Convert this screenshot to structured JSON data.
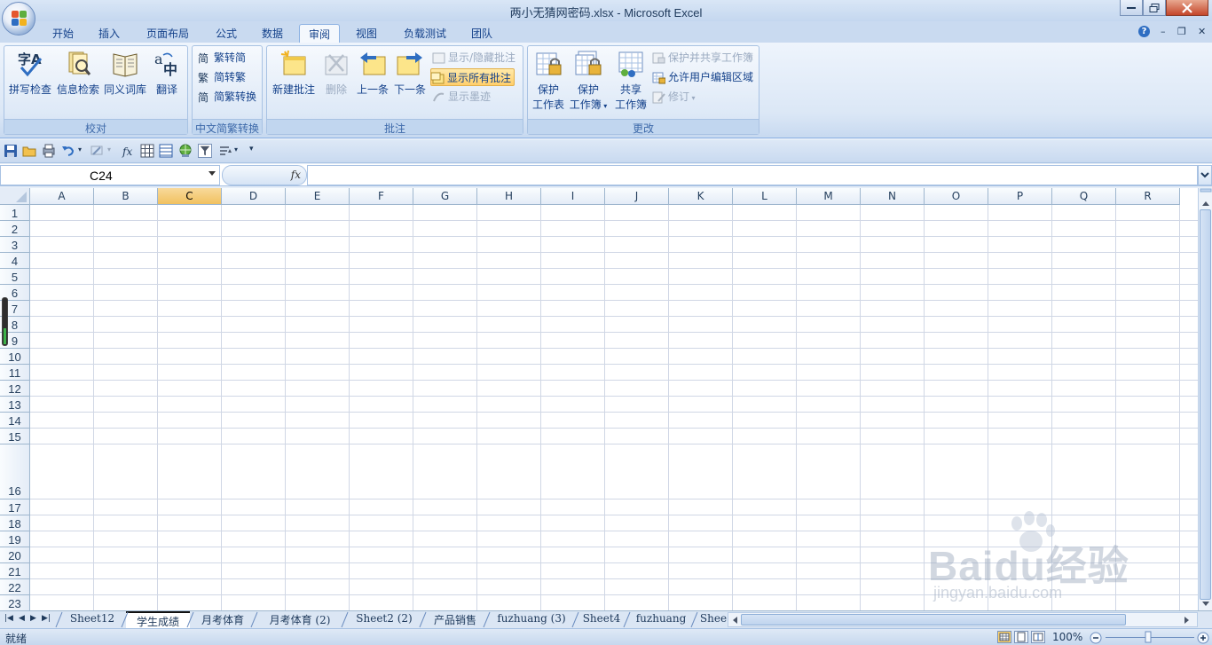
{
  "window": {
    "title": "两小无猜网密码.xlsx - Microsoft Excel"
  },
  "tabs": [
    "开始",
    "插入",
    "页面布局",
    "公式",
    "数据",
    "审阅",
    "视图",
    "负载测试",
    "团队"
  ],
  "active_tab": "审阅",
  "ribbon": {
    "proofing": {
      "label": "校对",
      "buttons": [
        "拼写检查",
        "信息检索",
        "同义词库",
        "翻译"
      ]
    },
    "chinese_conversion": {
      "label": "中文简繁转换",
      "buttons": [
        "繁转简",
        "简转繁",
        "简繁转换"
      ]
    },
    "comments": {
      "label": "批注",
      "new_comment": "新建批注",
      "delete": "删除",
      "previous": "上一条",
      "next": "下一条",
      "show_hide": "显示/隐藏批注",
      "show_all": "显示所有批注",
      "show_ink": "显示墨迹"
    },
    "changes": {
      "label": "更改",
      "protect_sheet": [
        "保护",
        "工作表"
      ],
      "protect_workbook": [
        "保护",
        "工作簿"
      ],
      "share_workbook": [
        "共享",
        "工作簿"
      ],
      "protect_share": "保护并共享工作簿",
      "allow_edit": "允许用户编辑区域",
      "track_changes": "修订"
    }
  },
  "formula_bar": {
    "name_box": "C24",
    "fx": "fx",
    "formula": ""
  },
  "grid": {
    "columns": [
      "A",
      "B",
      "C",
      "D",
      "E",
      "F",
      "G",
      "H",
      "I",
      "J",
      "K",
      "L",
      "M",
      "N",
      "O",
      "P",
      "Q",
      "R"
    ],
    "selected_column": "C",
    "rows": [
      "1",
      "2",
      "3",
      "4",
      "5",
      "6",
      "7",
      "8",
      "9",
      "10",
      "11",
      "12",
      "13",
      "14",
      "15",
      "16",
      "17",
      "18",
      "19",
      "20",
      "21",
      "22",
      "23"
    ]
  },
  "sheets": [
    "Sheet12",
    "学生成绩",
    "月考体育",
    "月考体育 (2)",
    "Sheet2 (2)",
    "产品销售",
    "fuzhuang (3)",
    "Sheet4",
    "fuzhuang",
    "Shee"
  ],
  "active_sheet": "学生成绩",
  "status": {
    "text": "就绪",
    "zoom": "100%"
  },
  "watermark": {
    "brand": "Baidu经验",
    "url": "jingyan.baidu.com"
  },
  "colors": {
    "accent": "#15428b",
    "selected_header": "#f1c15f",
    "grid_line": "#d0d7e5"
  }
}
